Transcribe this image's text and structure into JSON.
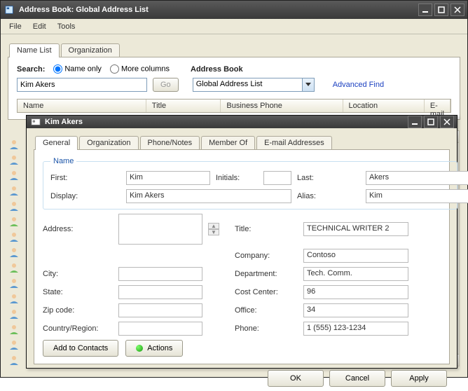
{
  "window": {
    "title": "Address Book: Global Address List",
    "menus": [
      "File",
      "Edit",
      "Tools"
    ]
  },
  "tabs": {
    "name_list": "Name List",
    "organization": "Organization"
  },
  "search": {
    "label": "Search:",
    "opt_name": "Name only",
    "opt_cols": "More columns",
    "ab_label": "Address Book",
    "value": "Kim Akers",
    "go": "Go",
    "ab_value": "Global Address List",
    "adv": "Advanced Find"
  },
  "cols": {
    "name": "Name",
    "title": "Title",
    "bphone": "Business Phone",
    "loc": "Location",
    "email": "E-mail"
  },
  "dialog": {
    "title": "Kim Akers",
    "tabs": {
      "general": "General",
      "org": "Organization",
      "phone": "Phone/Notes",
      "member": "Member Of",
      "email": "E-mail Addresses"
    },
    "name_legend": "Name",
    "labels": {
      "first": "First:",
      "initials": "Initials:",
      "last": "Last:",
      "display": "Display:",
      "alias": "Alias:",
      "address": "Address:",
      "title": "Title:",
      "company": "Company:",
      "city": "City:",
      "dept": "Department:",
      "state": "State:",
      "costcenter": "Cost Center:",
      "zip": "Zip code:",
      "office": "Office:",
      "country": "Country/Region:",
      "phone": "Phone:"
    },
    "vals": {
      "first": "Kim",
      "initials": "",
      "last": "Akers",
      "display": "Kim Akers",
      "alias": "Kim",
      "address": "",
      "title": "TECHNICAL WRITER 2",
      "company": "Contoso",
      "city": "",
      "dept": "Tech. Comm.",
      "state": "",
      "costcenter": "96",
      "zip": "",
      "office": "34",
      "country": "",
      "phone": "1 (555) 123-1234"
    },
    "buttons": {
      "add": "Add to Contacts",
      "actions": "Actions",
      "ok": "OK",
      "cancel": "Cancel",
      "apply": "Apply"
    }
  }
}
